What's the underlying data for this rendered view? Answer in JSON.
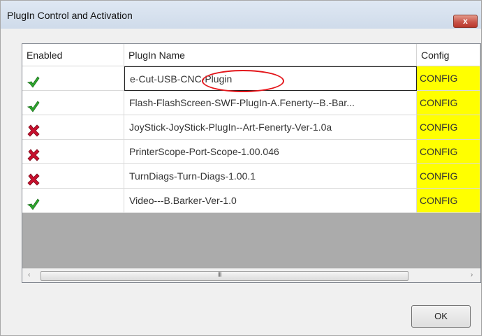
{
  "window": {
    "title": "PlugIn Control and Activation",
    "close_label": "x"
  },
  "grid": {
    "columns": {
      "enabled": "Enabled",
      "name": "PlugIn Name",
      "config": "Config"
    },
    "rows": [
      {
        "enabled": true,
        "enabled_icon": "green-check-icon",
        "name": "e-Cut-USB-CNC-Plugin",
        "config": "CONFIG"
      },
      {
        "enabled": true,
        "enabled_icon": "green-check-icon",
        "name": "Flash-FlashScreen-SWF-PlugIn-A.Fenerty--B.-Bar...",
        "config": "CONFIG"
      },
      {
        "enabled": false,
        "enabled_icon": "red-x-icon",
        "name": "JoyStick-JoyStick-PlugIn--Art-Fenerty-Ver-1.0a",
        "config": "CONFIG"
      },
      {
        "enabled": false,
        "enabled_icon": "red-x-icon",
        "name": "PrinterScope-Port-Scope-1.00.046",
        "config": "CONFIG"
      },
      {
        "enabled": false,
        "enabled_icon": "red-x-icon",
        "name": "TurnDiags-Turn-Diags-1.00.1",
        "config": "CONFIG"
      },
      {
        "enabled": true,
        "enabled_icon": "green-check-icon",
        "name": "Video---B.Barker-Ver-1.0",
        "config": "CONFIG"
      }
    ],
    "scroll": {
      "left": "‹",
      "grip": "III",
      "right": "›"
    }
  },
  "buttons": {
    "ok": "OK"
  },
  "colors": {
    "config_bg": "#ffff00",
    "highlight_ring": "#e3151a",
    "enabled": "#2ea82e",
    "disabled": "#c8102e"
  }
}
